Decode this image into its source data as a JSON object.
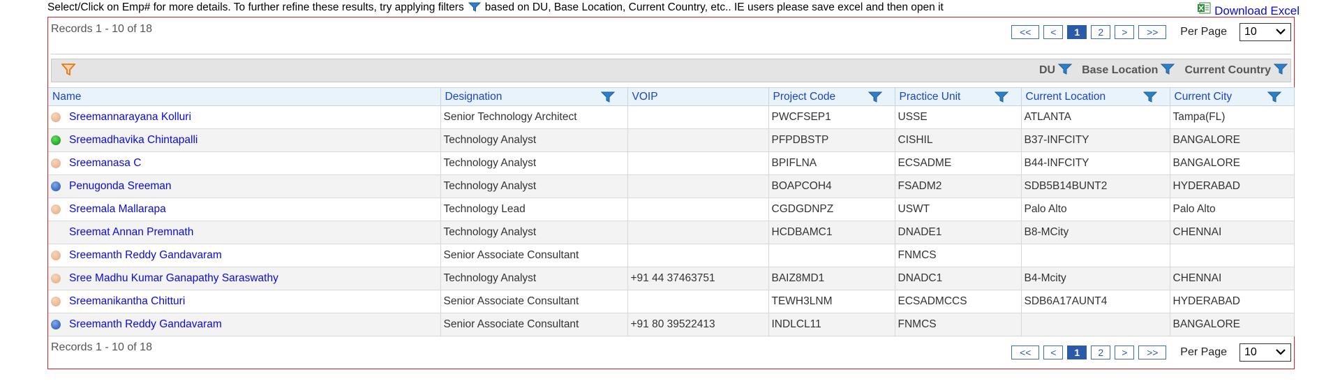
{
  "header": {
    "instruction_prefix": "Select/Click on Emp# for more details. To further refine these results, try applying filters",
    "instruction_suffix": "based on DU, Base Location, Current Country, etc.. IE users please save excel and then open it",
    "download_label": "Download Excel"
  },
  "records_text": "Records 1 - 10 of 18",
  "pagination": {
    "first": "<<",
    "prev": "<",
    "pages": [
      "1",
      "2"
    ],
    "current": "1",
    "next": ">",
    "last": ">>",
    "per_page_label": "Per Page",
    "per_page_value": "10"
  },
  "filter_bar": {
    "items": [
      "DU",
      "Base Location",
      "Current Country"
    ]
  },
  "table": {
    "columns": [
      "Name",
      "Designation",
      "VOIP",
      "Project Code",
      "Practice Unit",
      "Current Location",
      "Current City"
    ],
    "rows": [
      {
        "status": "away",
        "name": "Sreemannarayana Kolluri",
        "designation": "Senior Technology Architect",
        "voip": "",
        "project_code": "PWCFSEP1",
        "practice_unit": "USSE",
        "current_location": "ATLANTA",
        "current_city": "Tampa(FL)"
      },
      {
        "status": "online",
        "name": "Sreemadhavika Chintapalli",
        "designation": "Technology Analyst",
        "voip": "",
        "project_code": "PFPDBSTP",
        "practice_unit": "CISHIL",
        "current_location": "B37-INFCITY",
        "current_city": "BANGALORE"
      },
      {
        "status": "away",
        "name": "Sreemanasa C",
        "designation": "Technology Analyst",
        "voip": "",
        "project_code": "BPIFLNA",
        "practice_unit": "ECSADME",
        "current_location": "B44-INFCITY",
        "current_city": "BANGALORE"
      },
      {
        "status": "busy",
        "name": "Penugonda Sreeman",
        "designation": "Technology Analyst",
        "voip": "",
        "project_code": "BOAPCOH4",
        "practice_unit": "FSADM2",
        "current_location": "SDB5B14BUNT2",
        "current_city": "HYDERABAD"
      },
      {
        "status": "away",
        "name": "Sreemala Mallarapa",
        "designation": "Technology Lead",
        "voip": "",
        "project_code": "CGDGDNPZ",
        "practice_unit": "USWT",
        "current_location": "Palo Alto",
        "current_city": "Palo Alto"
      },
      {
        "status": "none",
        "name": "Sreemat Annan Premnath",
        "designation": "Technology Analyst",
        "voip": "",
        "project_code": "HCDBAMC1",
        "practice_unit": "DNADE1",
        "current_location": "B8-MCity",
        "current_city": "CHENNAI"
      },
      {
        "status": "away",
        "name": "Sreemanth Reddy Gandavaram",
        "designation": "Senior Associate Consultant",
        "voip": "",
        "project_code": "",
        "practice_unit": "FNMCS",
        "current_location": "",
        "current_city": ""
      },
      {
        "status": "away",
        "name": "Sree Madhu Kumar Ganapathy Saraswathy",
        "designation": "Technology Analyst",
        "voip": "+91 44 37463751",
        "project_code": "BAIZ8MD1",
        "practice_unit": "DNADC1",
        "current_location": "B4-Mcity",
        "current_city": "CHENNAI"
      },
      {
        "status": "away",
        "name": "Sreemanikantha Chitturi",
        "designation": "Senior Associate Consultant",
        "voip": "",
        "project_code": "TEWH3LNM",
        "practice_unit": "ECSADMCCS",
        "current_location": "SDB6A17AUNT4",
        "current_city": "HYDERABAD"
      },
      {
        "status": "busy",
        "name": "Sreemanth Reddy Gandavaram",
        "designation": "Senior Associate Consultant",
        "voip": "+91 80 39522413",
        "project_code": "INDLCL11",
        "practice_unit": "FNMCS",
        "current_location": "",
        "current_city": "BANGALORE"
      }
    ]
  },
  "colors": {
    "panel_border": "#e41e26",
    "link": "#0a0ae0",
    "header_text": "#1a44c4",
    "pager_active": "#2b5aa8",
    "filter_icon_blue": "#2f7fc6",
    "filter_icon_orange": "#f08a24"
  },
  "icons": {
    "filter": "funnel-icon",
    "excel": "excel-icon",
    "select_arrow": "chevron-down-icon"
  }
}
